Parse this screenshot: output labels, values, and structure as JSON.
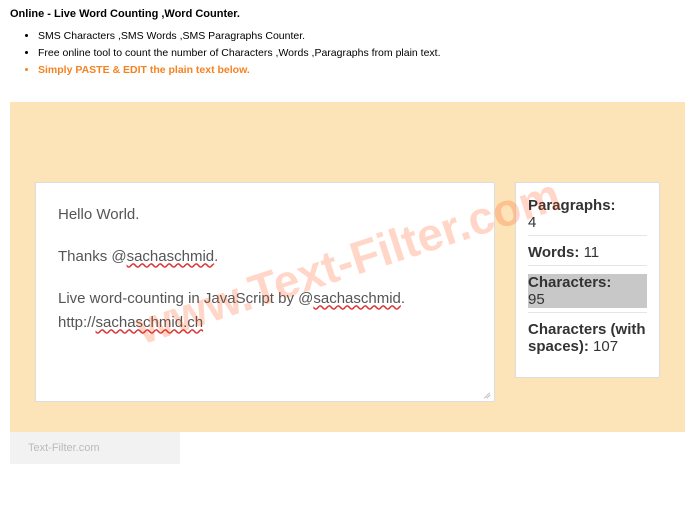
{
  "header": {
    "title": "Online - Live Word Counting ,Word Counter.",
    "bullets": [
      "SMS Characters ,SMS Words ,SMS Paragraphs Counter.",
      "Free online tool to count the number of Characters ,Words ,Paragraphs from plain text."
    ],
    "highlight": "Simply PASTE & EDIT the plain text below."
  },
  "watermark": "www.Text-Filter.com",
  "editor": {
    "line1_a": "Hello World.",
    "line2_a": "Thanks @",
    "line2_err": "sachaschmid",
    "line2_b": ".",
    "line3_a": "Live word-counting in JavaScript by @",
    "line3_err": "sachaschmid",
    "line3_b": ".",
    "line4_a": "http://",
    "line4_err": "sachaschmid.ch"
  },
  "stats": {
    "paragraphs": {
      "label": "Paragraphs:",
      "value": "4"
    },
    "words": {
      "label": "Words:",
      "value": "11"
    },
    "characters": {
      "label": "Characters:",
      "value": "95"
    },
    "chars_spaces": {
      "label": "Characters (with spaces):",
      "value": "107"
    }
  },
  "footer": "Text-Filter.com"
}
